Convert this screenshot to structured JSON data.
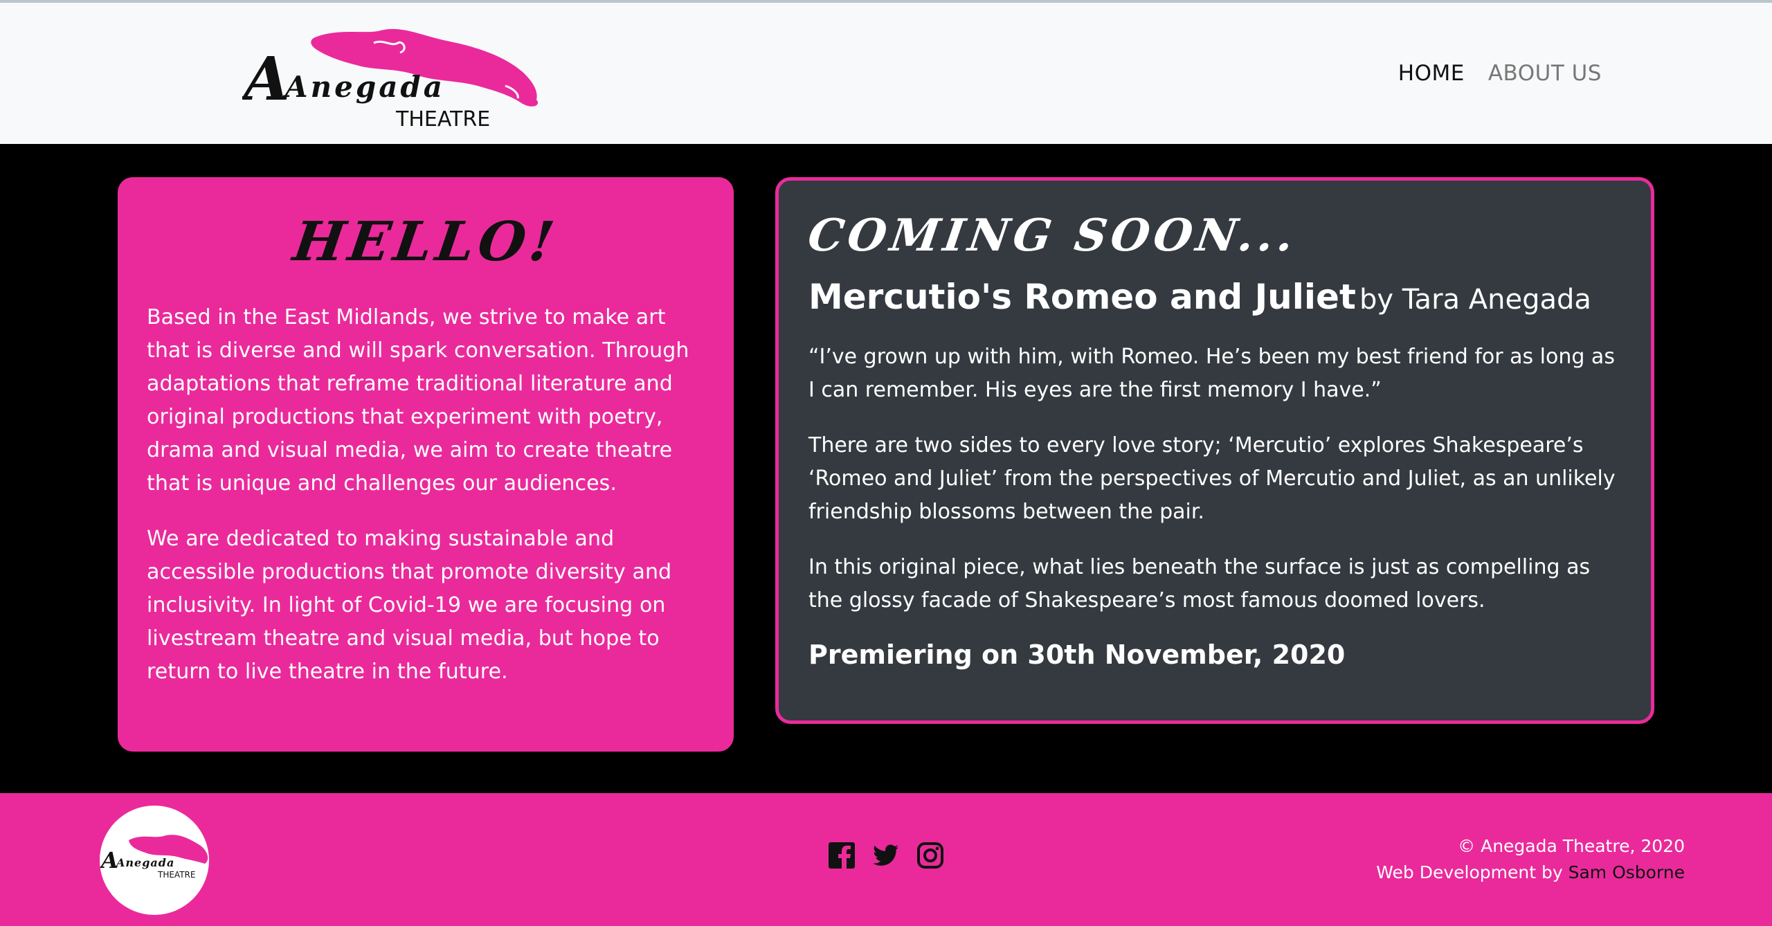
{
  "header": {
    "logo_word": "Anegada",
    "logo_sub": "THEATRE",
    "nav": [
      {
        "label": "HOME",
        "active": true
      },
      {
        "label": "ABOUT US",
        "active": false
      }
    ]
  },
  "hello": {
    "title": "HELLO!",
    "paragraphs": [
      "Based in the East Midlands, we strive to make art that is diverse and will spark conversation. Through adaptations that reframe traditional literature and original productions that experiment with poetry, drama and visual media, we aim to create theatre that is unique and challenges our audiences.",
      "We are dedicated to making sustainable and accessible productions that promote diversity and inclusivity. In light of Covid-19 we are focusing on livestream theatre and visual media, but hope to return to live theatre in the future."
    ]
  },
  "coming": {
    "title": "COMING SOON...",
    "play_title": "Mercutio's Romeo and Juliet",
    "play_by": "by Tara Anegada",
    "paragraphs": [
      "“I’ve grown up with him, with Romeo. He’s been my best friend for as long as I can remember. His eyes are the first memory I have.”",
      "There are two sides to every love story; ‘Mercutio’ explores Shakespeare’s ‘Romeo and Juliet’ from the perspectives of Mercutio and Juliet, as an unlikely friendship blossoms between the pair.",
      "In this original piece, what lies beneath the surface is just as compelling as the glossy facade of Shakespeare’s most famous doomed lovers."
    ],
    "premiere": "Premiering on 30th November, 2020"
  },
  "footer": {
    "logo_word": "Anegada",
    "logo_sub": "THEATRE",
    "social": [
      "facebook-icon",
      "twitter-icon",
      "instagram-icon"
    ],
    "copyright": "© Anegada Theatre, 2020",
    "dev_prefix": "Web Development by",
    "dev_name": "Sam Osborne"
  },
  "colors": {
    "brand_pink": "#ea2a9b",
    "card_dark": "#343a40",
    "header_bg": "#f8f9fa"
  }
}
